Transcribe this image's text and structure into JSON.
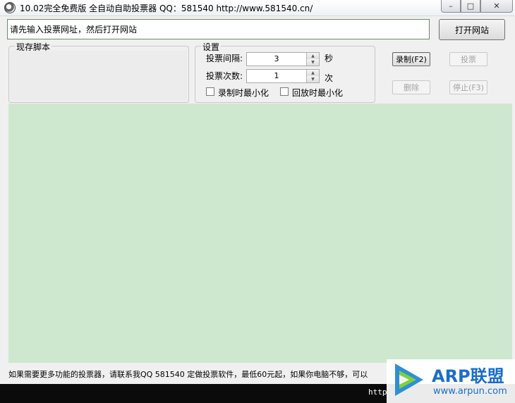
{
  "window": {
    "title": "10.02完全免费版 全自动自助投票器 QQ：581540  http://www.581540.cn/",
    "controls": {
      "minimize": "–",
      "maximize": "□",
      "close": "✕"
    }
  },
  "url_bar": {
    "value": "请先输入投票网址，然后打开网站",
    "open_button": "打开网站"
  },
  "scripts": {
    "title": "现存脚本"
  },
  "settings": {
    "title": "设置",
    "interval_label": "投票间隔:",
    "interval_value": "3",
    "interval_unit": "秒",
    "count_label": "投票次数:",
    "count_value": "1",
    "count_unit": "次",
    "minimize_on_record": "录制时最小化",
    "minimize_on_replay": "回放时最小化"
  },
  "actions": {
    "record": "录制(F2)",
    "vote": "投票",
    "delete": "删除",
    "stop": "停止(F3)"
  },
  "status": {
    "text": "如果需要更多功能的投票器，请联系我QQ 581540 定做投票软件，最低60元起，如果你电脑不够，可以"
  },
  "footer": {
    "url": "http"
  },
  "watermark": {
    "brand": "ARP联盟",
    "site": "www.arpun.com"
  },
  "colors": {
    "browser_bg": "#cde8cf",
    "accent": "#1a6ec8"
  }
}
